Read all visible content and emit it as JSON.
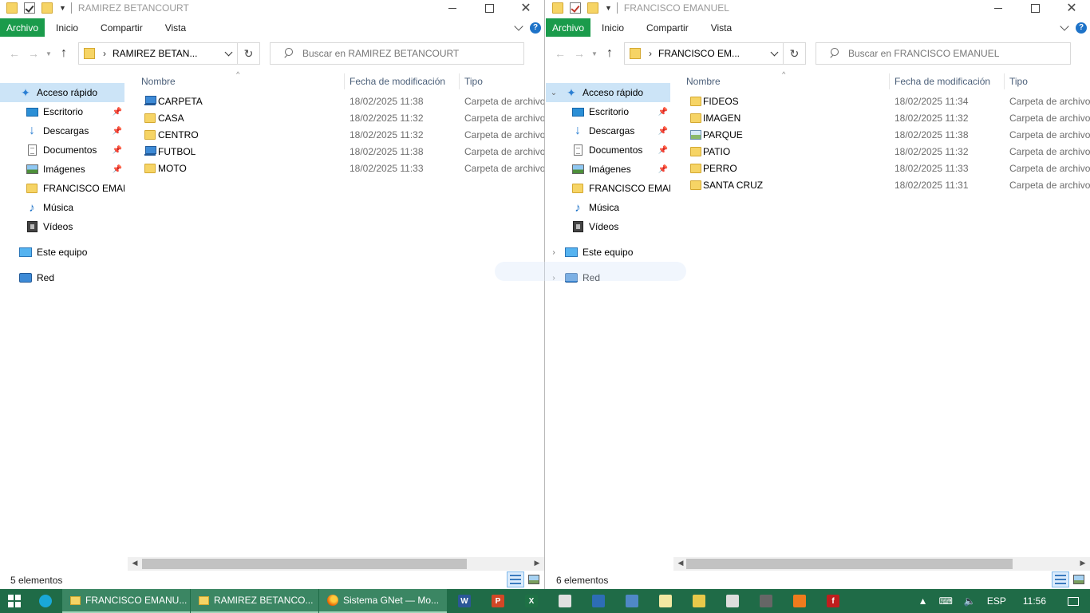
{
  "left_window": {
    "title": "RAMIREZ BETANCOURT",
    "ribbon_tabs": [
      "Archivo",
      "Inicio",
      "Compartir",
      "Vista"
    ],
    "address": "RAMIREZ BETAN...",
    "search_placeholder": "Buscar en RAMIREZ BETANCOURT",
    "nav": [
      {
        "label": "Acceso rápido",
        "icon": "star-icon"
      },
      {
        "label": "Escritorio",
        "icon": "desktop-icon",
        "pinned": true
      },
      {
        "label": "Descargas",
        "icon": "download-icon",
        "pinned": true
      },
      {
        "label": "Documentos",
        "icon": "document-icon",
        "pinned": true
      },
      {
        "label": "Imágenes",
        "icon": "pictures-icon",
        "pinned": true
      },
      {
        "label": "FRANCISCO EMANU",
        "icon": "folder-icon"
      },
      {
        "label": "Música",
        "icon": "music-icon"
      },
      {
        "label": "Vídeos",
        "icon": "video-icon"
      },
      {
        "label": "Este equipo",
        "icon": "computer-icon"
      },
      {
        "label": "Red",
        "icon": "network-icon"
      }
    ],
    "columns": {
      "name": "Nombre",
      "date": "Fecha de modificación",
      "type": "Tipo"
    },
    "files": [
      {
        "name": "CARPETA",
        "date": "18/02/2025 11:38",
        "type": "Carpeta de archivos",
        "icon": "network-folder-icon"
      },
      {
        "name": "CASA",
        "date": "18/02/2025 11:32",
        "type": "Carpeta de archivos",
        "icon": "folder-icon"
      },
      {
        "name": "CENTRO",
        "date": "18/02/2025 11:32",
        "type": "Carpeta de archivos",
        "icon": "folder-icon"
      },
      {
        "name": "FUTBOL",
        "date": "18/02/2025 11:38",
        "type": "Carpeta de archivos",
        "icon": "network-folder-icon"
      },
      {
        "name": "MOTO",
        "date": "18/02/2025 11:33",
        "type": "Carpeta de archivos",
        "icon": "folder-icon"
      }
    ],
    "status": "5 elementos"
  },
  "right_window": {
    "title": "FRANCISCO EMANUEL",
    "ribbon_tabs": [
      "Archivo",
      "Inicio",
      "Compartir",
      "Vista"
    ],
    "address": "FRANCISCO EM...",
    "search_placeholder": "Buscar en FRANCISCO EMANUEL",
    "nav": [
      {
        "label": "Acceso rápido",
        "icon": "star-icon"
      },
      {
        "label": "Escritorio",
        "icon": "desktop-icon",
        "pinned": true
      },
      {
        "label": "Descargas",
        "icon": "download-icon",
        "pinned": true
      },
      {
        "label": "Documentos",
        "icon": "document-icon",
        "pinned": true
      },
      {
        "label": "Imágenes",
        "icon": "pictures-icon",
        "pinned": true
      },
      {
        "label": "FRANCISCO EMANU",
        "icon": "folder-icon"
      },
      {
        "label": "Música",
        "icon": "music-icon"
      },
      {
        "label": "Vídeos",
        "icon": "video-icon"
      },
      {
        "label": "Este equipo",
        "icon": "computer-icon"
      },
      {
        "label": "Red",
        "icon": "network-icon"
      }
    ],
    "columns": {
      "name": "Nombre",
      "date": "Fecha de modificación",
      "type": "Tipo"
    },
    "files": [
      {
        "name": "FIDEOS",
        "date": "18/02/2025 11:34",
        "type": "Carpeta de archivos",
        "icon": "folder-icon"
      },
      {
        "name": "IMAGEN",
        "date": "18/02/2025 11:32",
        "type": "Carpeta de archivos",
        "icon": "folder-icon"
      },
      {
        "name": "PARQUE",
        "date": "18/02/2025 11:38",
        "type": "Carpeta de archivos",
        "icon": "image-folder-icon"
      },
      {
        "name": "PATIO",
        "date": "18/02/2025 11:32",
        "type": "Carpeta de archivos",
        "icon": "folder-icon"
      },
      {
        "name": "PERRO",
        "date": "18/02/2025 11:33",
        "type": "Carpeta de archivos",
        "icon": "folder-icon"
      },
      {
        "name": "SANTA CRUZ",
        "date": "18/02/2025 11:31",
        "type": "Carpeta de archivos",
        "icon": "folder-icon"
      }
    ],
    "status": "6 elementos"
  },
  "taskbar": {
    "tasks": [
      {
        "label": "FRANCISCO EMANU...",
        "icon": "folder-icon"
      },
      {
        "label": "RAMIREZ BETANCO...",
        "icon": "folder-icon"
      },
      {
        "label": "Sistema GNet — Mo...",
        "icon": "firefox-icon"
      }
    ],
    "apps": [
      "word-icon",
      "powerpoint-icon",
      "excel-icon",
      "app-icon",
      "app-icon",
      "app-icon",
      "notepad-icon",
      "pen-icon",
      "app-icon",
      "app-icon",
      "xampp-icon",
      "filezilla-icon"
    ],
    "language": "ESP",
    "time": "11:56"
  },
  "colors": {
    "file_tab": "#1a9b4b",
    "taskbar": "#1f6b47",
    "selection": "#cce4f7"
  }
}
